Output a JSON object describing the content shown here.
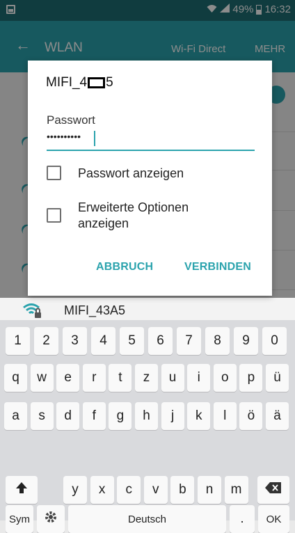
{
  "status_bar": {
    "battery": "49%",
    "time": "16:32"
  },
  "app_bar": {
    "back_icon": "arrow-left-icon",
    "title": "WLAN",
    "wifi_direct": "Wi-Fi Direct",
    "more": "MEHR"
  },
  "dialog": {
    "title_prefix": "MIFI_4",
    "title_suffix": "5",
    "password_label": "Passwort",
    "password_value": "••••••••••",
    "show_password_label": "Passwort anzeigen",
    "advanced_options_label_line1": "Erweiterte Optionen",
    "advanced_options_label_line2": "anzeigen",
    "cancel_button": "ABBRUCH",
    "connect_button": "VERBINDEN"
  },
  "network_list": {
    "visible_item": "MIFI_43A5"
  },
  "keyboard": {
    "rows": [
      [
        "1",
        "2",
        "3",
        "4",
        "5",
        "6",
        "7",
        "8",
        "9",
        "0"
      ],
      [
        "q",
        "w",
        "e",
        "r",
        "t",
        "z",
        "u",
        "i",
        "o",
        "p",
        "ü"
      ],
      [
        "a",
        "s",
        "d",
        "f",
        "g",
        "h",
        "j",
        "k",
        "l",
        "ö",
        "ä"
      ],
      [
        "y",
        "x",
        "c",
        "v",
        "b",
        "n",
        "m"
      ]
    ],
    "shift_icon": "shift-arrow-icon",
    "backspace_icon": "backspace-icon",
    "sym_label": "Sym",
    "settings_icon": "gear-icon",
    "space_label": "Deutsch",
    "period_label": ".",
    "ok_label": "OK"
  },
  "colors": {
    "accent": "#2ba3ad",
    "status_bar": "#1e6e73"
  }
}
